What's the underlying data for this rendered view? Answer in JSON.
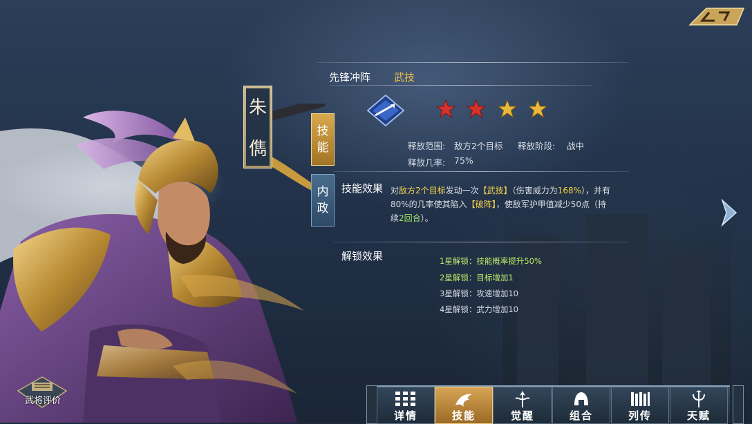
{
  "hero": {
    "name_chars": [
      "朱",
      "儁"
    ]
  },
  "side_tabs": [
    {
      "label_1": "技",
      "label_2": "能"
    },
    {
      "label_1": "内",
      "label_2": "政"
    }
  ],
  "skill": {
    "name": "先锋冲阵",
    "type": "武技",
    "stars_total": 4,
    "stars_filled": 2,
    "range_label": "释放范围:",
    "range_value": "敌方2个目标",
    "phase_label": "释放阶段:",
    "phase_value": "战中",
    "rate_label": "释放几率:",
    "rate_value": "75%"
  },
  "effect": {
    "title": "技能效果",
    "seg_1": "对",
    "seg_2": "敌方2个目标",
    "seg_3": "发动一次",
    "seg_4": "【武技】",
    "seg_5": "（伤害威力为",
    "seg_6": "168%",
    "seg_7": "），并有80%的几率使其陷入",
    "seg_8": "【破阵】",
    "seg_9": "，使敌军护甲值减少50点（持续",
    "seg_10": "2回合",
    "seg_11": "）。"
  },
  "unlock": {
    "title": "解锁效果",
    "items": [
      "1星解锁：技能概率提升50%",
      "2星解锁：目标增加1",
      "3星解锁：攻速增加10",
      "4星解锁：武力增加10"
    ]
  },
  "rating_button": {
    "label": "武将评价"
  },
  "bottom_nav": [
    {
      "label": "详情",
      "icon": "grid-icon"
    },
    {
      "label": "技能",
      "icon": "dragon-icon"
    },
    {
      "label": "觉醒",
      "icon": "spear-icon"
    },
    {
      "label": "组合",
      "icon": "helmet-icon"
    },
    {
      "label": "列传",
      "icon": "scroll-icon"
    },
    {
      "label": "天赋",
      "icon": "trident-icon"
    }
  ],
  "colors": {
    "gold": "#f3c24a",
    "highlight_green": "#9fe56a",
    "highlight_yellow": "#f3d34a",
    "star_red": "#d8322c",
    "star_gold": "#e9b93c"
  }
}
